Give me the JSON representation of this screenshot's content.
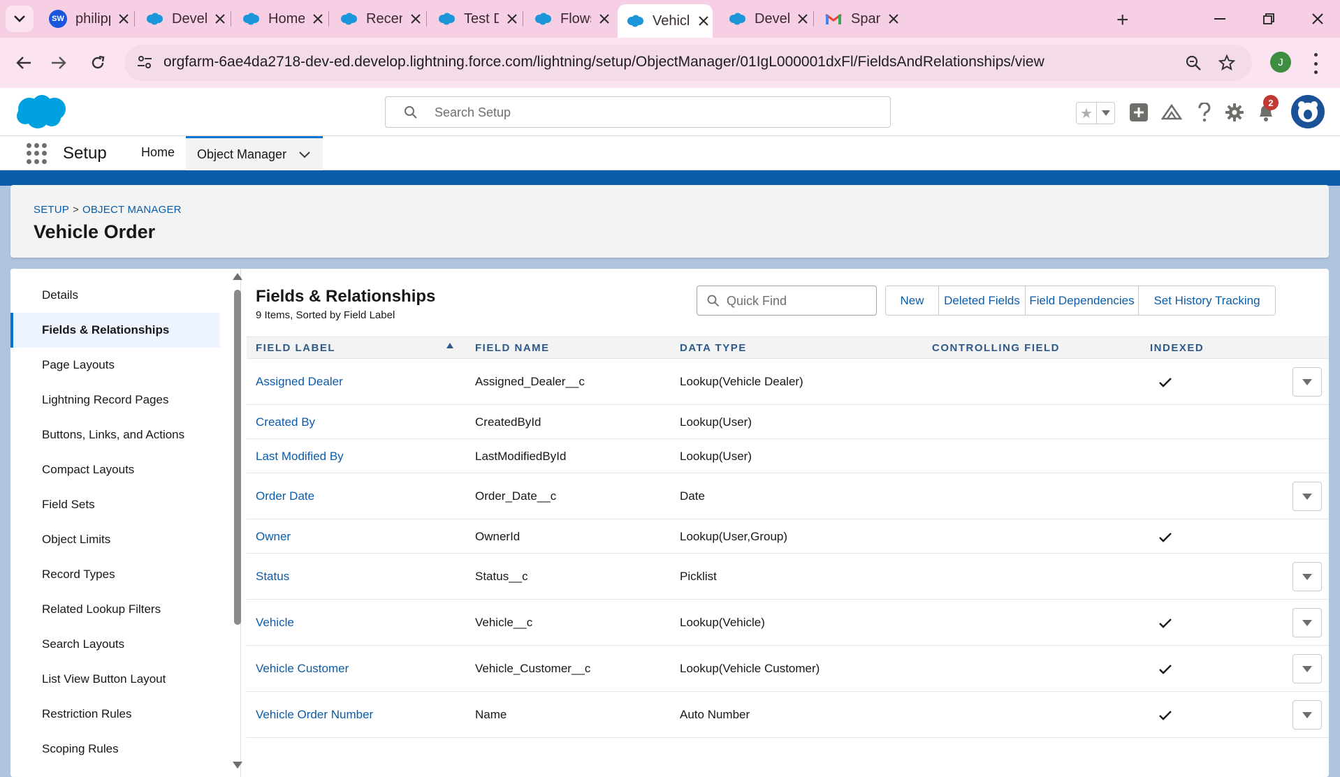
{
  "browser": {
    "tabs": [
      {
        "title": "philippi",
        "icon": "sw-avatar-icon"
      },
      {
        "title": "Develop",
        "icon": "salesforce-cloud-icon"
      },
      {
        "title": "Home |",
        "icon": "salesforce-cloud-icon"
      },
      {
        "title": "Recently",
        "icon": "salesforce-cloud-icon"
      },
      {
        "title": "Test Driv",
        "icon": "salesforce-cloud-icon"
      },
      {
        "title": "Flows |",
        "icon": "salesforce-cloud-icon"
      },
      {
        "title": "Vehicle",
        "icon": "salesforce-cloud-icon",
        "active": true
      },
      {
        "title": "Develop",
        "icon": "salesforce-cloud-icon"
      },
      {
        "title": "Spam -",
        "icon": "gmail-icon"
      }
    ],
    "sw_initials": "SW",
    "url": "orgfarm-6ae4da2718-dev-ed.develop.lightning.force.com/lightning/setup/ObjectManager/01IgL000001dxFl/FieldsAndRelationships/view",
    "profile_initial": "J"
  },
  "header": {
    "search_placeholder": "Search Setup",
    "notification_count": "2"
  },
  "nav": {
    "app_name": "Setup",
    "home": "Home",
    "object_manager": "Object Manager"
  },
  "page": {
    "breadcrumb_setup": "SETUP",
    "breadcrumb_sep": ">",
    "breadcrumb_object_manager": "OBJECT MANAGER",
    "title": "Vehicle Order"
  },
  "sidebar": {
    "items": [
      {
        "label": "Details"
      },
      {
        "label": "Fields & Relationships",
        "active": true
      },
      {
        "label": "Page Layouts"
      },
      {
        "label": "Lightning Record Pages"
      },
      {
        "label": "Buttons, Links, and Actions"
      },
      {
        "label": "Compact Layouts"
      },
      {
        "label": "Field Sets"
      },
      {
        "label": "Object Limits"
      },
      {
        "label": "Record Types"
      },
      {
        "label": "Related Lookup Filters"
      },
      {
        "label": "Search Layouts"
      },
      {
        "label": "List View Button Layout"
      },
      {
        "label": "Restriction Rules"
      },
      {
        "label": "Scoping Rules"
      }
    ]
  },
  "fields": {
    "title": "Fields & Relationships",
    "subtitle": "9 Items, Sorted by Field Label",
    "quick_find_placeholder": "Quick Find",
    "buttons": {
      "new": "New",
      "deleted_fields": "Deleted Fields",
      "field_dependencies": "Field Dependencies",
      "set_history_tracking": "Set History Tracking"
    },
    "columns": {
      "field_label": "FIELD LABEL",
      "field_name": "FIELD NAME",
      "data_type": "DATA TYPE",
      "controlling_field": "CONTROLLING FIELD",
      "indexed": "INDEXED"
    },
    "rows": [
      {
        "label": "Assigned Dealer",
        "name": "Assigned_Dealer__c",
        "type": "Lookup(Vehicle Dealer)",
        "controlling": "",
        "indexed": true,
        "has_action": true
      },
      {
        "label": "Created By",
        "name": "CreatedById",
        "type": "Lookup(User)",
        "controlling": "",
        "indexed": false,
        "has_action": false
      },
      {
        "label": "Last Modified By",
        "name": "LastModifiedById",
        "type": "Lookup(User)",
        "controlling": "",
        "indexed": false,
        "has_action": false
      },
      {
        "label": "Order Date",
        "name": "Order_Date__c",
        "type": "Date",
        "controlling": "",
        "indexed": false,
        "has_action": true
      },
      {
        "label": "Owner",
        "name": "OwnerId",
        "type": "Lookup(User,Group)",
        "controlling": "",
        "indexed": true,
        "has_action": false
      },
      {
        "label": "Status",
        "name": "Status__c",
        "type": "Picklist",
        "controlling": "",
        "indexed": false,
        "has_action": true
      },
      {
        "label": "Vehicle",
        "name": "Vehicle__c",
        "type": "Lookup(Vehicle)",
        "controlling": "",
        "indexed": true,
        "has_action": true
      },
      {
        "label": "Vehicle Customer",
        "name": "Vehicle_Customer__c",
        "type": "Lookup(Vehicle Customer)",
        "controlling": "",
        "indexed": true,
        "has_action": true
      },
      {
        "label": "Vehicle Order Number",
        "name": "Name",
        "type": "Auto Number",
        "controlling": "",
        "indexed": true,
        "has_action": true
      }
    ]
  },
  "colors": {
    "brand_blue": "#0176d3",
    "link_blue": "#0b5cab",
    "chrome_pink": "#f6cfe4",
    "salesforce_cloud": "#00a1e0"
  }
}
